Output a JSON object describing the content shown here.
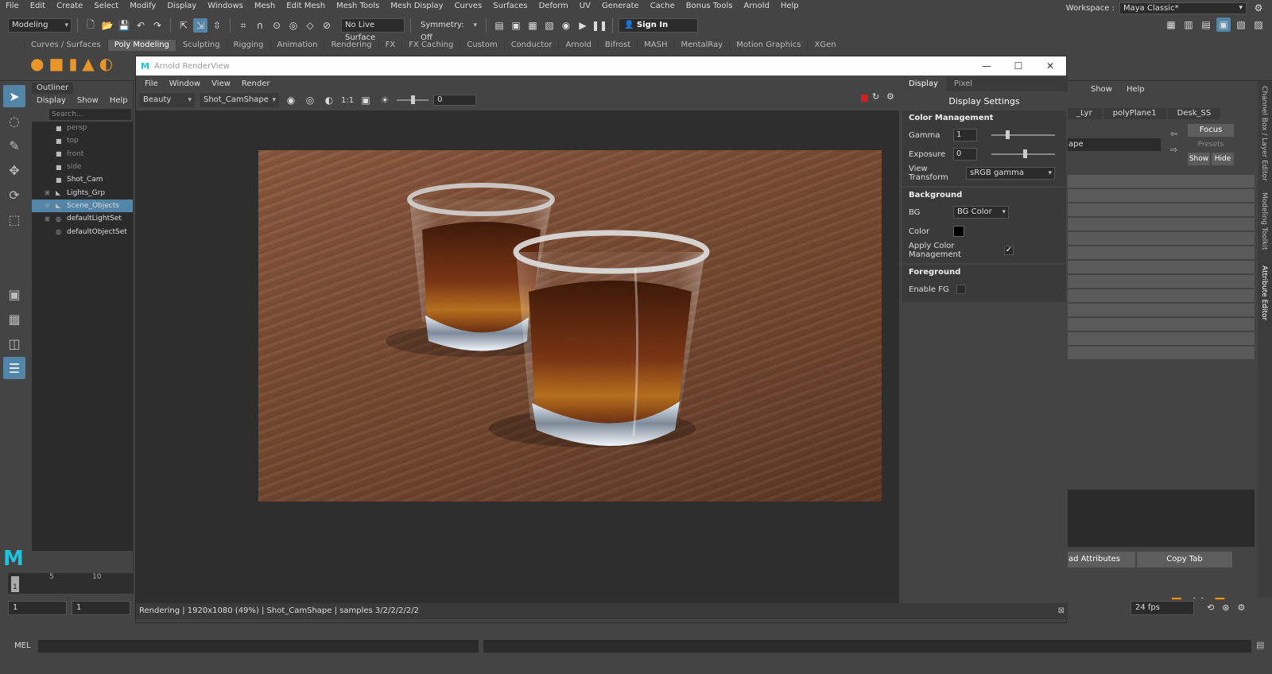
{
  "main_menu": [
    "File",
    "Edit",
    "Create",
    "Select",
    "Modify",
    "Display",
    "Windows",
    "Mesh",
    "Edit Mesh",
    "Mesh Tools",
    "Mesh Display",
    "Curves",
    "Surfaces",
    "Deform",
    "UV",
    "Generate",
    "Cache",
    "Bonus Tools",
    "Arnold",
    "Help"
  ],
  "workspace": {
    "label": "Workspace :",
    "value": "Maya Classic*"
  },
  "status_line": {
    "menu_set": "Modeling",
    "live_surface": "No Live Surface",
    "symmetry": "Symmetry: Off",
    "sign_in": "Sign In"
  },
  "shelf_tabs": [
    "Curves / Surfaces",
    "Poly Modeling",
    "Sculpting",
    "Rigging",
    "Animation",
    "Rendering",
    "FX",
    "FX Caching",
    "Custom",
    "Conductor",
    "Arnold",
    "Bifrost",
    "MASH",
    "MentalRay",
    "Motion Graphics",
    "XGen"
  ],
  "shelf_active": "Poly Modeling",
  "outliner": {
    "tab": "Outliner",
    "menu": [
      "Display",
      "Show",
      "Help"
    ],
    "search_placeholder": "Search...",
    "items": [
      {
        "label": "persp",
        "icon": "camera-icon",
        "dim": true
      },
      {
        "label": "top",
        "icon": "camera-icon",
        "dim": true
      },
      {
        "label": "front",
        "icon": "camera-icon",
        "dim": true
      },
      {
        "label": "side",
        "icon": "camera-icon",
        "dim": true
      },
      {
        "label": "Shot_Cam",
        "icon": "camera-icon",
        "dim": false
      },
      {
        "label": "Lights_Grp",
        "icon": "group-icon",
        "dim": false,
        "expand": true
      },
      {
        "label": "Scene_Objects",
        "icon": "group-icon",
        "dim": false,
        "expand": true,
        "selected": true
      },
      {
        "label": "defaultLightSet",
        "icon": "set-icon",
        "dim": false,
        "expand": true
      },
      {
        "label": "defaultObjectSet",
        "icon": "set-icon",
        "dim": false
      }
    ]
  },
  "render_view": {
    "title": "Arnold RenderView",
    "menu": [
      "File",
      "Window",
      "View",
      "Render"
    ],
    "aov": "Beauty",
    "camera": "Shot_CamShape",
    "ratio": "1:1",
    "exposure_value": "0",
    "status": "Rendering | 1920x1080 (49%) | Shot_CamShape  | samples 3/2/2/2/2/2"
  },
  "display_panel": {
    "tabs": [
      "Display",
      "Pixel"
    ],
    "title": "Display Settings",
    "color_management": {
      "header": "Color Management",
      "gamma_label": "Gamma",
      "gamma": "1",
      "exposure_label": "Exposure",
      "exposure": "0",
      "view_transform_label": "View Transform",
      "view_transform": "sRGB gamma"
    },
    "background": {
      "header": "Background",
      "bg_label": "BG",
      "bg_value": "BG Color",
      "color_label": "Color",
      "apply_label": "Apply Color Management"
    },
    "foreground": {
      "header": "Foreground",
      "enable_label": "Enable FG"
    }
  },
  "attribute_editor": {
    "menu": [
      "Show",
      "Help"
    ],
    "tabs": [
      "_Lyr",
      "polyPlane1",
      "Desk_SS"
    ],
    "name_field": "ape",
    "focus": "Focus",
    "presets": "Presets",
    "show": "Show",
    "hide": "Hide",
    "load_attributes": "ad Attributes",
    "copy_tab": "Copy Tab"
  },
  "side_tabs": [
    "Channel Box / Layer Editor",
    "Modeling Toolkit",
    "Attribute Editor"
  ],
  "time_slider": {
    "ticks": [
      "5",
      "10"
    ],
    "current": "1"
  },
  "range": {
    "start": "1",
    "start2": "1",
    "fps": "24 fps"
  },
  "command_line": {
    "label": "MEL"
  }
}
